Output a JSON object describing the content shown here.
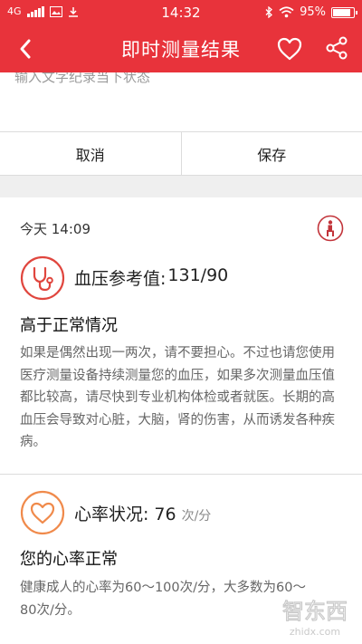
{
  "status_bar": {
    "network": "4G",
    "time": "14:32",
    "battery": "95%"
  },
  "header": {
    "title": "即时测量结果"
  },
  "note": {
    "placeholder": "输入文字纪录当下状态"
  },
  "actions": {
    "cancel_label": "取消",
    "save_label": "保存"
  },
  "result": {
    "time": "今天 14:09",
    "blood_pressure": {
      "label": "血压参考值:",
      "value": "131/90",
      "status": "高于正常情况",
      "advice": "如果是偶然出现一两次，请不要担心。不过也请您使用医疗测量设备持续测量您的血压，如果多次测量血压值都比较高，请尽快到专业机构体检或者就医。长期的高血压会导致对心脏，大脑，肾的伤害，从而诱发各种疾病。"
    },
    "heart_rate": {
      "label": "心率状况:",
      "value": "76",
      "unit": "次/分",
      "status": "您的心率正常",
      "advice": "健康成人的心率为60～100次/分，大多数为60～80次/分。"
    }
  },
  "watermark": {
    "text": "智东西",
    "sub": "zhidx.com"
  },
  "colors": {
    "accent": "#e8333b",
    "icon_blood_pressure": "#e0463e",
    "icon_heart_rate": "#f08a4b"
  }
}
